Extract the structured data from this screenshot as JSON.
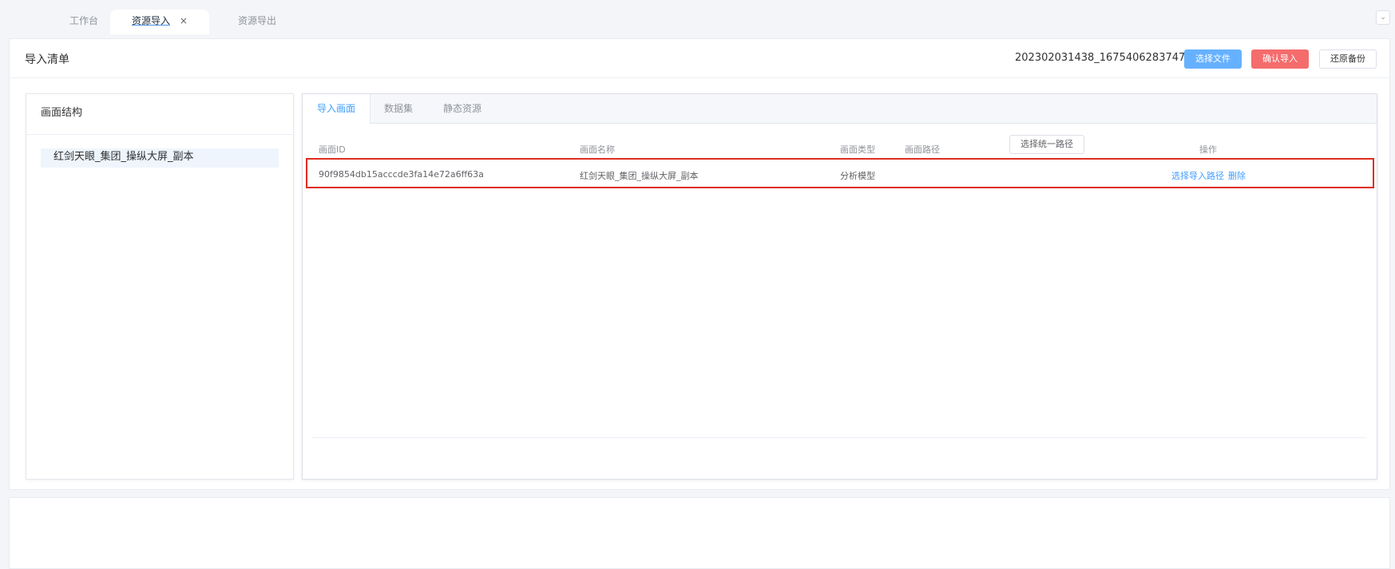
{
  "tabs": {
    "workbench": "工作台",
    "import": "资源导入",
    "import_close": "×",
    "export": "资源导出",
    "collapse_icon": "⌄"
  },
  "toolbar": {
    "title": "导入清单",
    "filename": "202302031438_1675406283747.zip",
    "choose_file": "选择文件",
    "confirm_import": "确认导入",
    "restore_backup": "还原备份",
    "confirm_color": "#f56c6c",
    "choose_color": "#66b1ff"
  },
  "structure": {
    "title": "画面结构",
    "items": [
      "红剑天眼_集团_操纵大屏_副本"
    ]
  },
  "detail": {
    "tabs": [
      "导入画面",
      "数据集",
      "静态资源"
    ],
    "columns": {
      "id": "画面ID",
      "name": "画面名称",
      "type": "画面类型",
      "path": "画面路径",
      "select_unified_path": "选择统一路径",
      "actions": "操作"
    },
    "rows": [
      {
        "id": "90f9854db15acccde3fa14e72a6ff63a",
        "name": "红剑天眼_集团_操纵大屏_副本",
        "type": "分析模型",
        "path": "",
        "action_select_path": "选择导入路径",
        "action_delete": "删除"
      }
    ]
  }
}
